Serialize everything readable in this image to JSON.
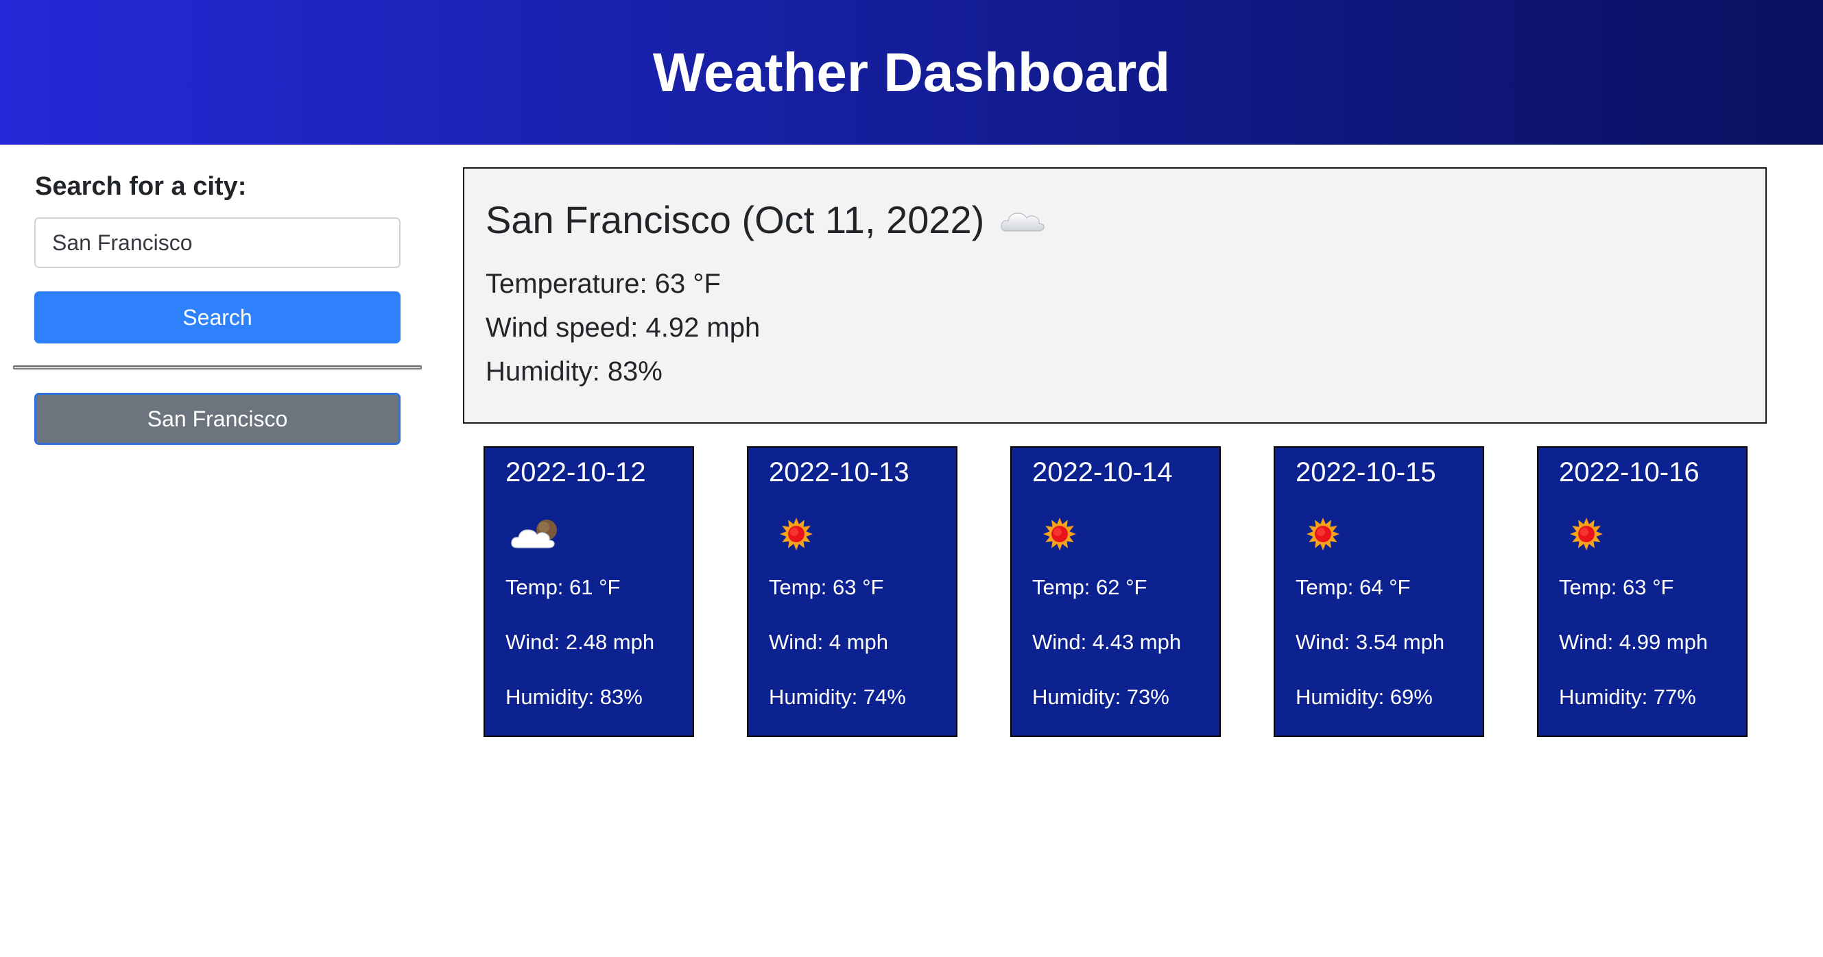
{
  "header": {
    "title": "Weather Dashboard"
  },
  "sidebar": {
    "search_label": "Search for a city:",
    "search_value": "San Francisco",
    "search_button": "Search",
    "history": [
      "San Francisco"
    ]
  },
  "current": {
    "title": "San Francisco (Oct 11, 2022)",
    "icon": "cloud-icon",
    "temperature": "Temperature: 63 °F",
    "wind": "Wind speed: 4.92 mph",
    "humidity": "Humidity: 83%"
  },
  "forecast": [
    {
      "date": "2022-10-12",
      "icon": "partly-cloudy-icon",
      "temp": "Temp: 61 °F",
      "wind": "Wind: 2.48 mph",
      "humidity": "Humidity: 83%"
    },
    {
      "date": "2022-10-13",
      "icon": "sun-icon",
      "temp": "Temp: 63 °F",
      "wind": "Wind: 4 mph",
      "humidity": "Humidity: 74%"
    },
    {
      "date": "2022-10-14",
      "icon": "sun-icon",
      "temp": "Temp: 62 °F",
      "wind": "Wind: 4.43 mph",
      "humidity": "Humidity: 73%"
    },
    {
      "date": "2022-10-15",
      "icon": "sun-icon",
      "temp": "Temp: 64 °F",
      "wind": "Wind: 3.54 mph",
      "humidity": "Humidity: 69%"
    },
    {
      "date": "2022-10-16",
      "icon": "sun-icon",
      "temp": "Temp: 63 °F",
      "wind": "Wind: 4.99 mph",
      "humidity": "Humidity: 77%"
    }
  ],
  "colors": {
    "header_start": "#2529d8",
    "header_end": "#0a1060",
    "search_button": "#2f80fb",
    "history_button": "#6c757d",
    "forecast_card": "#0c2290",
    "current_panel": "#f3f3f3"
  }
}
